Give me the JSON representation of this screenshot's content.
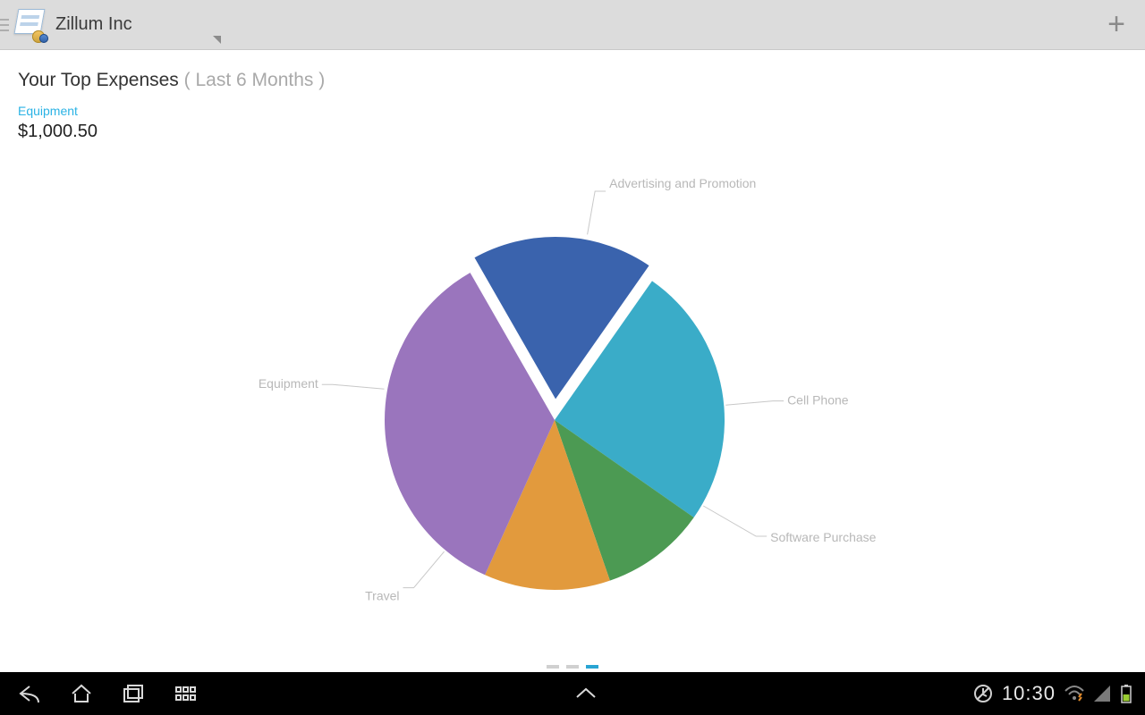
{
  "appbar": {
    "company": "Zillum Inc",
    "plus_label": "+"
  },
  "page": {
    "title": "Your Top Expenses",
    "subtitle": "( Last 6 Months )"
  },
  "selected": {
    "category": "Equipment",
    "amount": "$1,000.50"
  },
  "pager": {
    "count": 3,
    "active": 2
  },
  "statusbar": {
    "time": "10:30"
  },
  "colors": {
    "advertising": "#3aacc8",
    "cellphone": "#4c9a53",
    "software": "#e29a3d",
    "travel": "#9a75bd",
    "equipment": "#3a63ad",
    "label": "#b8b8b8",
    "accent": "#2bb3e5"
  },
  "chart_data": {
    "type": "pie",
    "title": "Your Top Expenses ( Last 6 Months )",
    "selected_slice": "Equipment",
    "selected_value_label": "$1,000.50",
    "series": [
      {
        "name": "Advertising and Promotion",
        "value": 25,
        "color": "#3aacc8"
      },
      {
        "name": "Cell Phone",
        "value": 10,
        "color": "#4c9a53"
      },
      {
        "name": "Software Purchase",
        "value": 12,
        "color": "#e29a3d"
      },
      {
        "name": "Travel",
        "value": 35,
        "color": "#9a75bd"
      },
      {
        "name": "Equipment",
        "value": 18,
        "color": "#3a63ad",
        "exploded": true
      }
    ],
    "note": "values are approximate percentages read from slice angles"
  }
}
